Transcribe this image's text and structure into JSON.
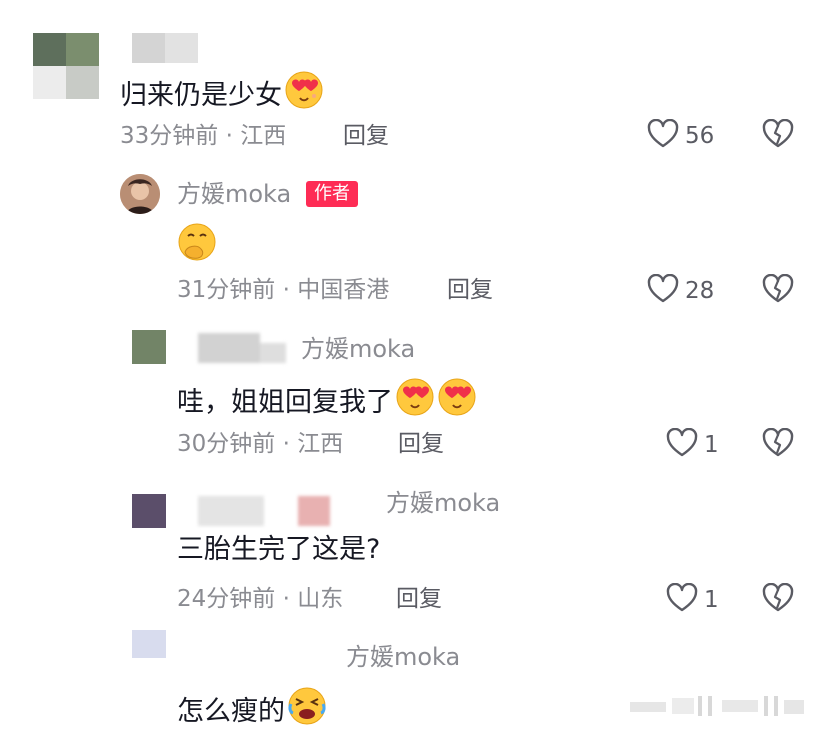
{
  "colors": {
    "text": "#161823",
    "secondary": "#8a8b91",
    "author_badge": "#fe2c55",
    "avatar_c1": "#6b8a6a",
    "avatar_c2": "#5a4a6b"
  },
  "comments": [
    {
      "text": "归来仍是少女",
      "emoji": "heart-eyes-emoji",
      "meta": "33分钟前 · 江西",
      "reply_label": "回复",
      "likes": "56"
    },
    {
      "name": "方媛moka",
      "badge": "作者",
      "emoji": "hand-over-mouth-emoji",
      "meta": "31分钟前 · 中国香港",
      "reply_label": "回复",
      "likes": "28"
    },
    {
      "reply_to": "方媛moka",
      "text": "哇，姐姐回复我了",
      "emoji": "heart-eyes-emoji",
      "meta": "30分钟前 · 江西",
      "reply_label": "回复",
      "likes": "1"
    },
    {
      "reply_to": "方媛moka",
      "text": "三胎生完了这是?",
      "meta": "24分钟前 · 山东",
      "reply_label": "回复",
      "likes": "1"
    },
    {
      "reply_to": "方媛moka",
      "text": "怎么瘦的",
      "emoji": "grimace-tears-emoji"
    }
  ]
}
